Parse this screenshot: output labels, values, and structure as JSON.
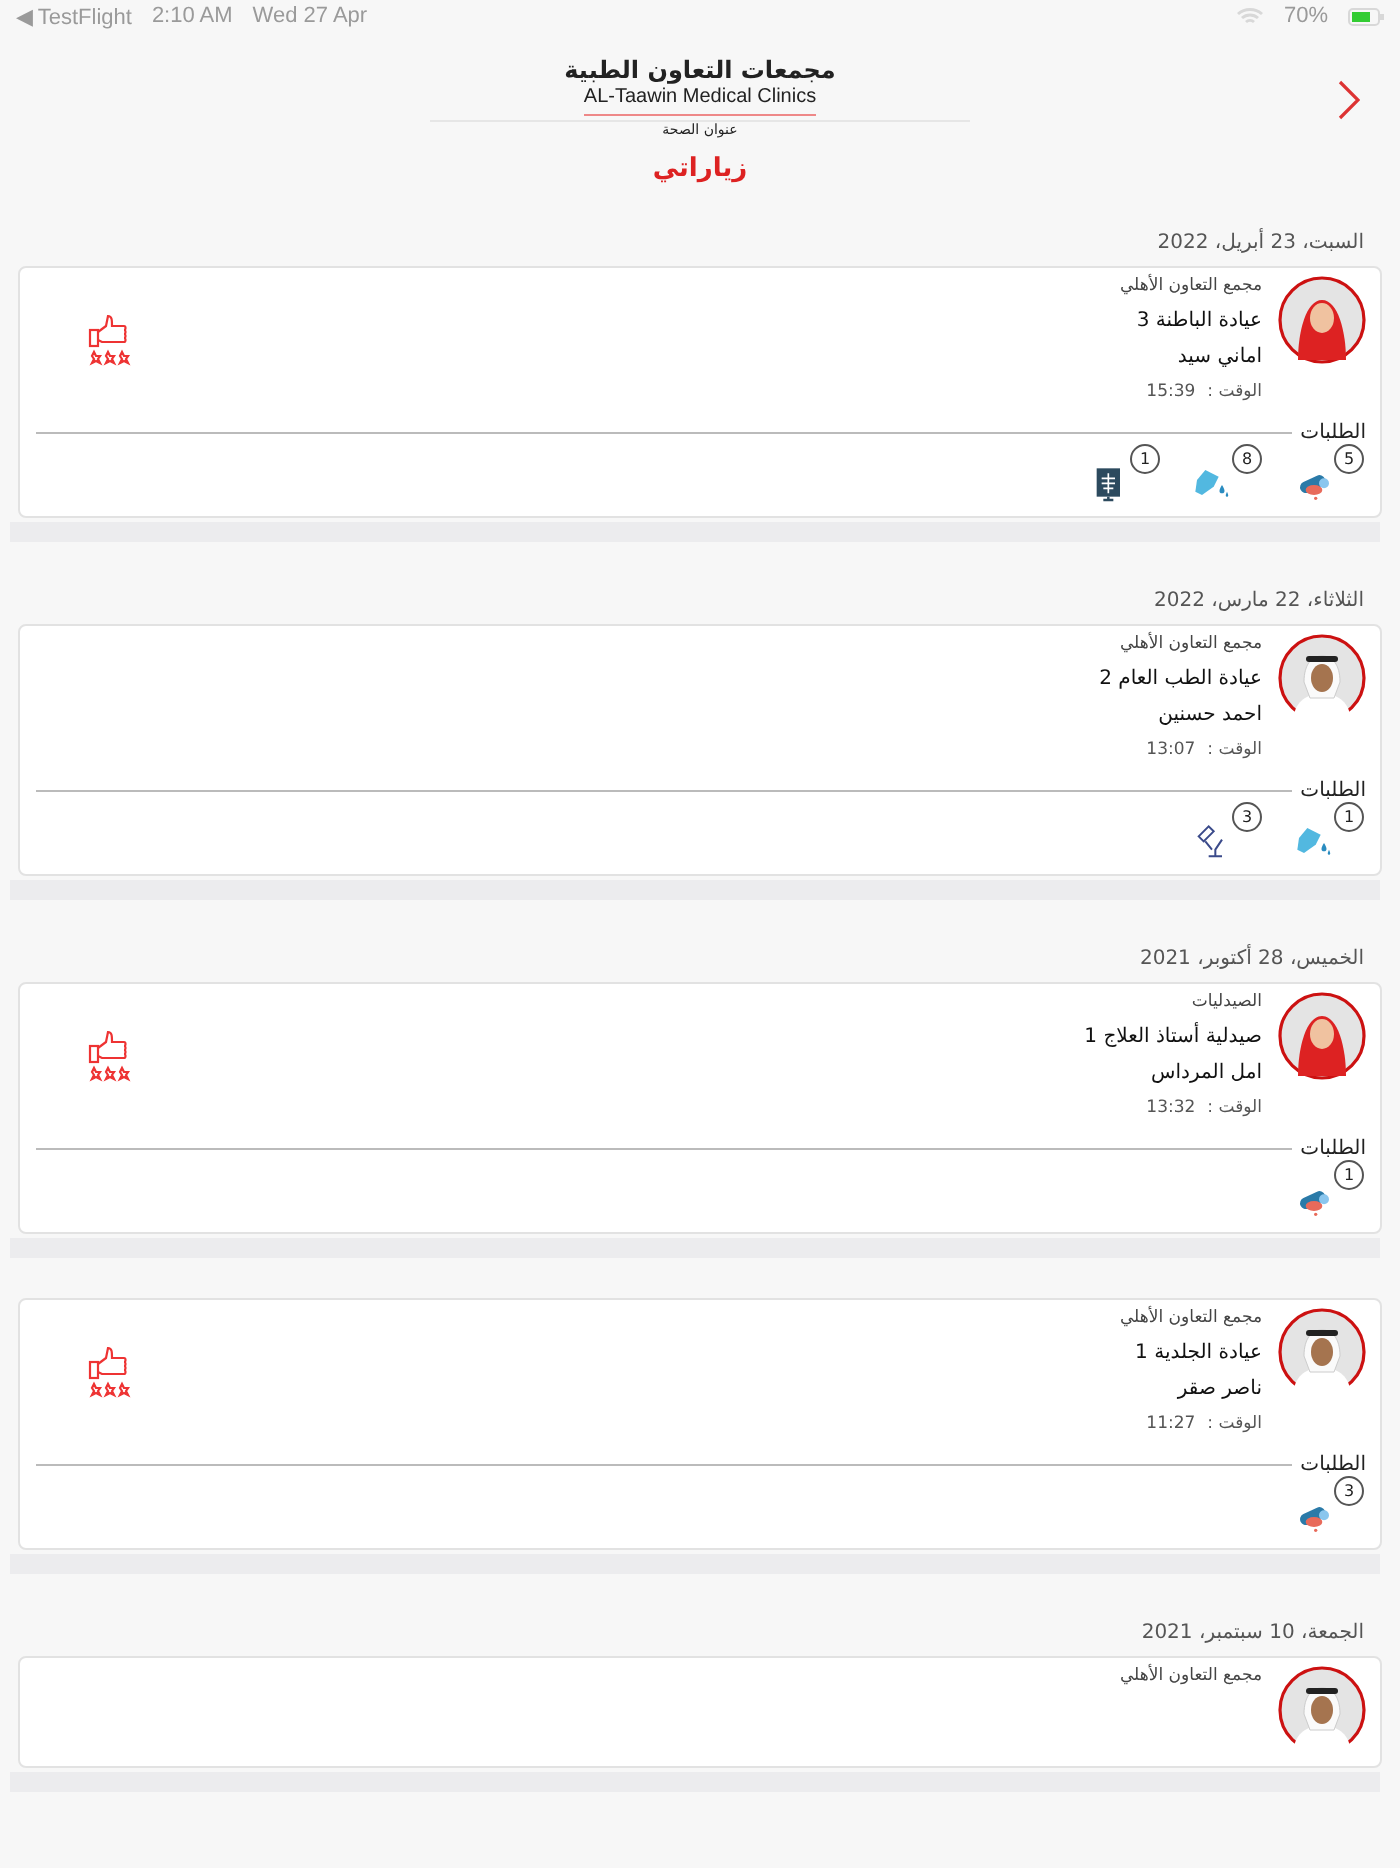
{
  "status_bar": {
    "back_app": "◀ TestFlight",
    "time": "2:10 AM",
    "date": "Wed 27 Apr",
    "battery": "70%"
  },
  "header": {
    "title": "مجمعات التعاون الطبية",
    "subtitle": "AL-Taawin Medical Clinics",
    "tagline": "عنوان الصحة",
    "page_title": "زياراتي"
  },
  "visits": [
    {
      "date": "السبت، 23 أبريل، 2022",
      "avatar": {
        "kind": "female"
      },
      "group": "مجمع التعاون الأهلي",
      "clinic": "عيادة الباطنة 3",
      "doctor": "اماني سيد",
      "time_label": "الوقت :",
      "time": "15:39",
      "rated": true,
      "requests_label": "الطلبات",
      "requests": [
        {
          "kind": "pills",
          "count": "5"
        },
        {
          "kind": "lab",
          "count": "8"
        },
        {
          "kind": "xray",
          "count": "1"
        }
      ]
    },
    {
      "date": "الثلاثاء، 22 مارس، 2022",
      "avatar": {
        "kind": "male"
      },
      "group": "مجمع التعاون الأهلي",
      "clinic": "عيادة الطب العام 2",
      "doctor": "احمد حسنين",
      "time_label": "الوقت :",
      "time": "13:07",
      "rated": false,
      "requests_label": "الطلبات",
      "requests": [
        {
          "kind": "lab",
          "count": "1"
        },
        {
          "kind": "scope",
          "count": "3"
        }
      ]
    },
    {
      "date": "الخميس، 28 أكتوبر، 2021",
      "avatar": {
        "kind": "female"
      },
      "group": "الصيدليات",
      "clinic": "صيدلية أستاذ العلاج 1",
      "doctor": "امل المرداس",
      "time_label": "الوقت :",
      "time": "13:32",
      "rated": true,
      "requests_label": "الطلبات",
      "requests": [
        {
          "kind": "pills",
          "count": "1"
        }
      ]
    },
    {
      "avatar": {
        "kind": "male"
      },
      "group": "مجمع التعاون الأهلي",
      "clinic": "عيادة الجلدية 1",
      "doctor": "ناصر صقر",
      "time_label": "الوقت :",
      "time": "11:27",
      "rated": true,
      "requests_label": "الطلبات",
      "requests": [
        {
          "kind": "pills",
          "count": "3"
        }
      ]
    },
    {
      "date": "الجمعة، 10 سبتمبر، 2021",
      "avatar": {
        "kind": "male"
      },
      "group": "مجمع التعاون الأهلي"
    }
  ]
}
